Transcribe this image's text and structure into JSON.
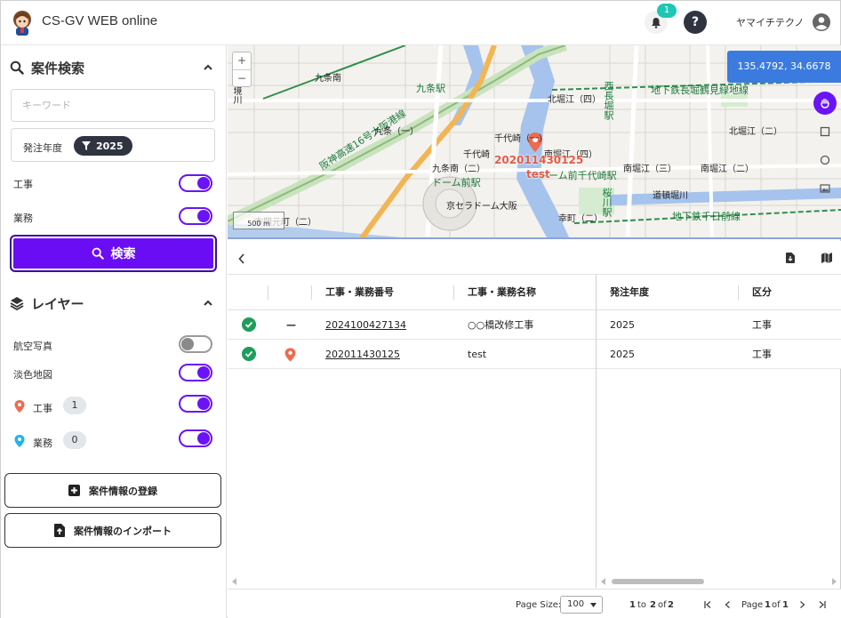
{
  "header": {
    "app_title": "CS-GV WEB online",
    "notification_count": "1",
    "help_label": "?",
    "user_name": "ヤマイチテクノ"
  },
  "sidebar": {
    "search_section": {
      "title": "案件検索",
      "keyword_placeholder": "キーワード",
      "year_label": "発注年度",
      "year_value": "2025",
      "filters": [
        {
          "label": "工事",
          "on": true
        },
        {
          "label": "業務",
          "on": true
        }
      ],
      "search_button": "検索"
    },
    "layer_section": {
      "title": "レイヤー",
      "layers": [
        {
          "label": "航空写真",
          "on": false
        },
        {
          "label": "淡色地図",
          "on": true
        },
        {
          "label": "工事",
          "count": "1",
          "on": true,
          "pin_color": "#f06a4e"
        },
        {
          "label": "業務",
          "count": "0",
          "on": true,
          "pin_color": "#1fb6e6"
        }
      ]
    },
    "register_button": "案件情報の登録",
    "import_button": "案件情報のインポート"
  },
  "map": {
    "zoom_in": "+",
    "zoom_out": "−",
    "coordinates": "135.4792, 34.6678",
    "scale_label": "500 m",
    "marker_label": "202011430125",
    "marker_sub": "test",
    "labels": [
      "九条南",
      "九条駅",
      "千代崎",
      "九条南（二）",
      "北堀江（四）",
      "北堀江（二）",
      "南堀江（四）",
      "南堀江（三）",
      "南堀江（二）",
      "京セラドーム大阪",
      "ドーム前駅",
      "阪神高速16号大阪港線",
      "地下鉄長堀鶴見緑地線",
      "地下鉄千日前線",
      "ドーム前千代崎駅",
      "西長堀駅",
      "桜川駅",
      "市岡元町（二）",
      "境川",
      "千代崎（一）",
      "九条（一）",
      "幸町（二）",
      "道頓堀川"
    ]
  },
  "grid": {
    "columns": [
      "工事・業務番号",
      "工事・業務名称",
      "発注年度",
      "区分"
    ],
    "rows": [
      {
        "number": "2024100427134",
        "name": "○○橋改修工事",
        "year": "2025",
        "category": "工事",
        "status": "ok",
        "pin": "—"
      },
      {
        "number": "202011430125",
        "name": "test",
        "year": "2025",
        "category": "工事",
        "status": "ok",
        "pin": "pin"
      }
    ]
  },
  "pager": {
    "page_size_label": "Page Size:",
    "page_size": "100",
    "range_from": "1",
    "range_to_label": "to",
    "range_to": "2",
    "of_label": "of",
    "total": "2",
    "page_label": "Page",
    "page_current": "1",
    "page_total": "1"
  },
  "colors": {
    "accent": "#6a0df5",
    "success": "#1f9d5c",
    "coord_bg": "#3b7be0",
    "marker": "#e25a46"
  }
}
